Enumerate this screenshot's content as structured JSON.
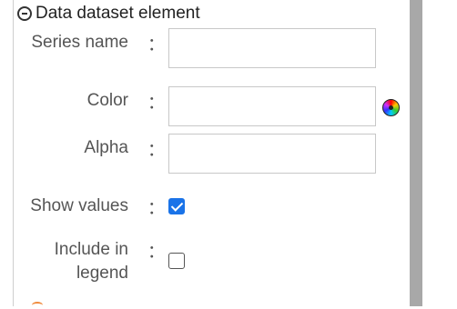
{
  "section": {
    "title": "Data dataset element"
  },
  "form": {
    "colon": "：",
    "series_name": {
      "label": "Series name",
      "value": ""
    },
    "color": {
      "label": "Color",
      "value": ""
    },
    "alpha": {
      "label": "Alpha",
      "value": ""
    },
    "show_values": {
      "label": "Show values",
      "checked": true
    },
    "include_in_legend": {
      "label_line1": "Include in",
      "label_line2": "legend",
      "checked": false
    }
  },
  "icons": {
    "collapse": "minus-circle-icon",
    "color_picker": "color-wheel-icon",
    "checkbox_checked": "check-icon"
  },
  "colors": {
    "checkbox_accent": "#1a73e8",
    "scrollbar": "#a8a8a8",
    "border": "#c8c8c8",
    "next_section_accent": "#f08a3c"
  }
}
